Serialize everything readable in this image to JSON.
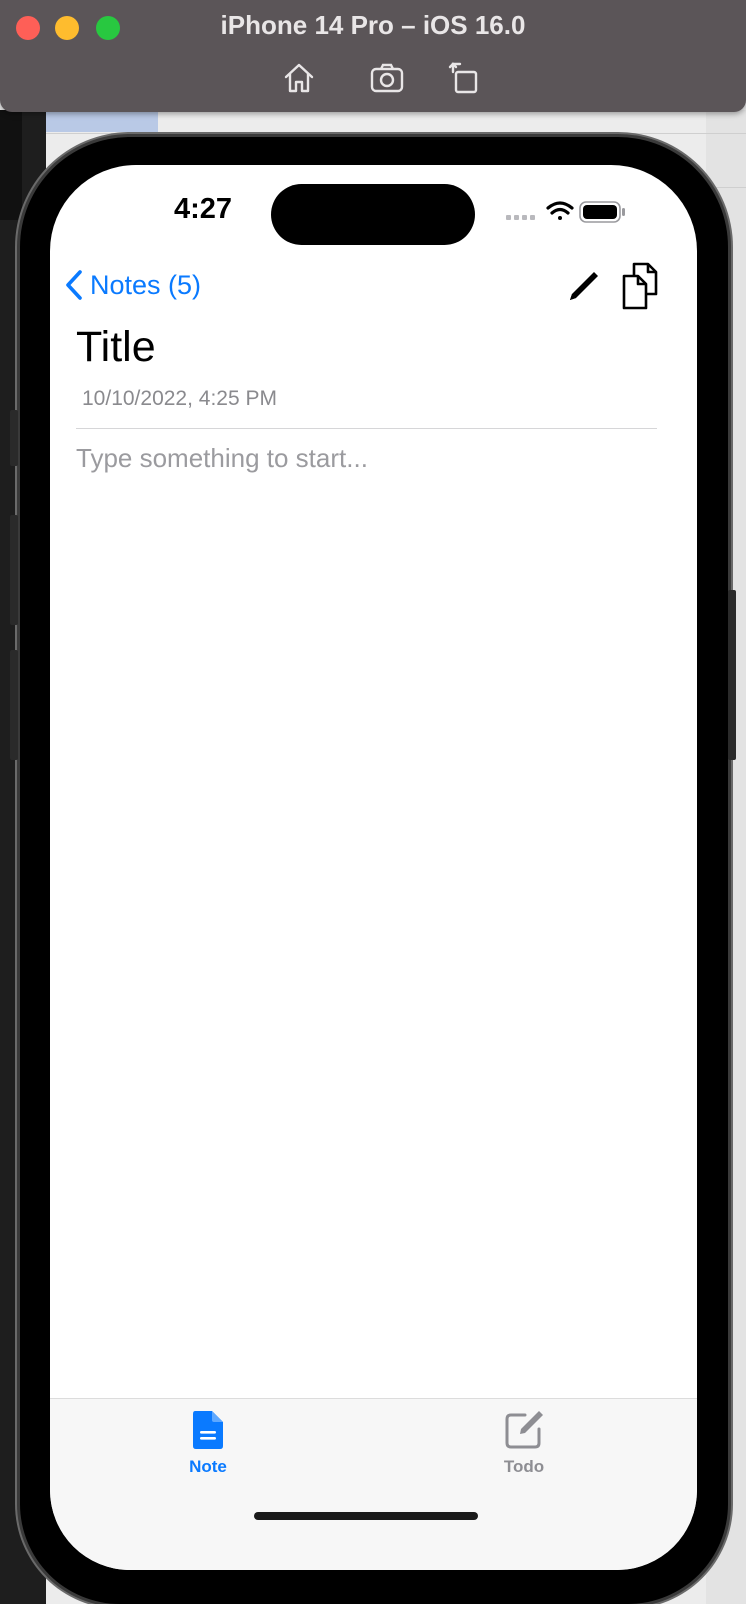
{
  "window": {
    "title": "iPhone 14 Pro – iOS 16.0",
    "toolbar_icons": [
      "home-icon",
      "screenshot-icon",
      "rotate-icon"
    ]
  },
  "status_bar": {
    "time": "4:27",
    "icons": [
      "cellular-icon",
      "wifi-icon",
      "battery-icon"
    ]
  },
  "nav": {
    "back_label": "Notes (5)",
    "actions": [
      "pencil-icon",
      "copy-icon"
    ],
    "accent_color": "#0a7aff"
  },
  "note": {
    "title": "Title",
    "date": "10/10/2022, 4:25 PM",
    "body_placeholder": "Type something to start...",
    "body_value": ""
  },
  "tabbar": {
    "tabs": [
      {
        "label": "Note",
        "icon": "document-icon",
        "active": true
      },
      {
        "label": "Todo",
        "icon": "compose-icon",
        "active": false
      }
    ]
  }
}
